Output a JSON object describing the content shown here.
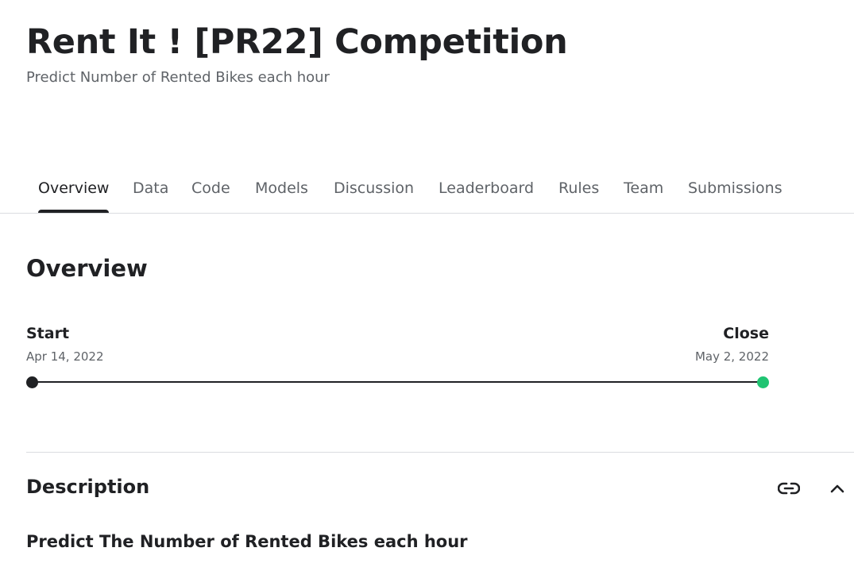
{
  "header": {
    "title": "Rent It ! [PR22] Competition",
    "subtitle": "Predict Number of Rented Bikes each hour"
  },
  "tabs": [
    {
      "label": "Overview",
      "active": true
    },
    {
      "label": "Data",
      "active": false
    },
    {
      "label": "Code",
      "active": false
    },
    {
      "label": "Models",
      "active": false
    },
    {
      "label": "Discussion",
      "active": false
    },
    {
      "label": "Leaderboard",
      "active": false
    },
    {
      "label": "Rules",
      "active": false
    },
    {
      "label": "Team",
      "active": false
    },
    {
      "label": "Submissions",
      "active": false
    }
  ],
  "overview": {
    "heading": "Overview",
    "timeline": {
      "start_label": "Start",
      "start_date": "Apr 14, 2022",
      "close_label": "Close",
      "close_date": "May 2, 2022",
      "start_color": "#202124",
      "close_color": "#20c472"
    }
  },
  "description": {
    "heading": "Description",
    "subheading": "Predict The Number of Rented Bikes each hour",
    "icons": [
      "link-icon",
      "chevron-up-icon"
    ]
  },
  "colors": {
    "text_primary": "#202124",
    "text_secondary": "#5f6368",
    "divider": "#dadce0",
    "accent_green": "#20c472"
  }
}
